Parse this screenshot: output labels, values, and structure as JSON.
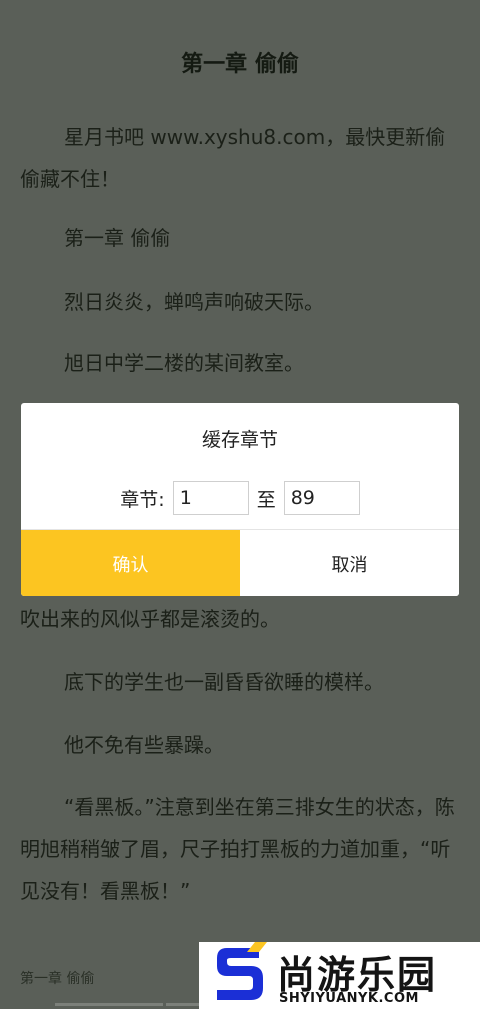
{
  "reader": {
    "chapter_title": "第一章 偷偷",
    "paragraphs": [
      "星月书吧 www.xyshu8.com，最快更新偷偷藏不住！",
      "第一章 偷偷",
      "烈日炎炎，蝉鸣声响破天际。",
      "旭日中学二楼的某间教室。",
      "吹出来的风似乎都是滚烫的。",
      "底下的学生也一副昏昏欲睡的模样。",
      "他不免有些暴躁。",
      "“看黑板。”注意到坐在第三排女生的状态，陈明旭稍稍皱了眉，尺子拍打黑板的力道加重，“听见没有！看黑板！”"
    ],
    "footer_chapter": "第一章 偷偷"
  },
  "dialog": {
    "title": "缓存章节",
    "range_label": "章节:",
    "from_value": "1",
    "to_label": "至",
    "to_value": "89",
    "confirm": "确认",
    "cancel": "取消"
  },
  "watermark": {
    "name": "尚游乐园",
    "url": "SHYIYUANYK.COM"
  },
  "colors": {
    "overlay_bg": "#5a5f58",
    "confirm_bg": "#fcc521",
    "watermark_blue": "#1b2fd6"
  }
}
